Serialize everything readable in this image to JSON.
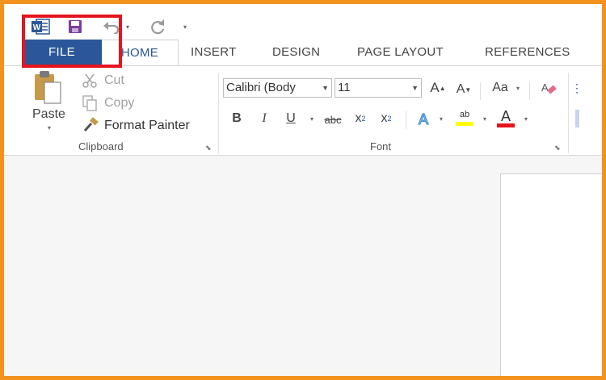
{
  "tabs": {
    "file": "FILE",
    "home": "HOME",
    "insert": "INSERT",
    "design": "DESIGN",
    "page_layout": "PAGE LAYOUT",
    "references": "REFERENCES"
  },
  "clipboard": {
    "paste": "Paste",
    "cut": "Cut",
    "copy": "Copy",
    "format_painter": "Format Painter",
    "group_label": "Clipboard"
  },
  "font": {
    "font_name": "Calibri (Body",
    "font_size": "11",
    "group_label": "Font",
    "change_case": "Aa",
    "bold": "B",
    "italic": "I",
    "underline": "U",
    "strikethrough": "abc",
    "subscript": "x",
    "subscript_mark": "2",
    "superscript": "x",
    "superscript_mark": "2",
    "highlight_text": "ab",
    "font_color_letter": "A"
  },
  "colors": {
    "file_tab": "#2b579a",
    "callout": "#e5141e",
    "frame": "#f3921e",
    "highlight_yellow": "#ffff00",
    "font_red": "#e5141e"
  },
  "icons": {
    "word": "word-logo-icon",
    "save": "save-icon",
    "undo": "undo-icon",
    "redo": "redo-icon",
    "customize": "customize-qat-icon"
  }
}
